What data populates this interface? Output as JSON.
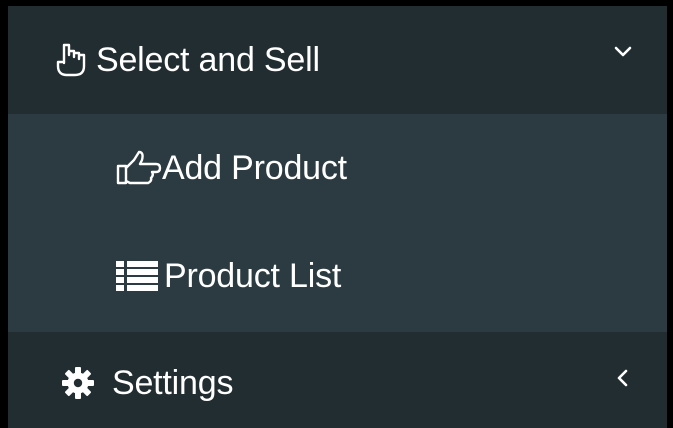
{
  "menu": {
    "select_and_sell": {
      "label": "Select and Sell",
      "icon": "hand-pointer-icon",
      "expanded": true
    },
    "submenu": [
      {
        "label": "Add Product",
        "icon": "hand-point-right-icon"
      },
      {
        "label": "Product List",
        "icon": "list-icon"
      }
    ],
    "settings": {
      "label": "Settings",
      "icon": "gear-icon",
      "expanded": false
    }
  },
  "colors": {
    "sidebar_bg": "#222d32",
    "submenu_bg": "#2c3b41",
    "text": "#ffffff",
    "frame": "#000000"
  }
}
